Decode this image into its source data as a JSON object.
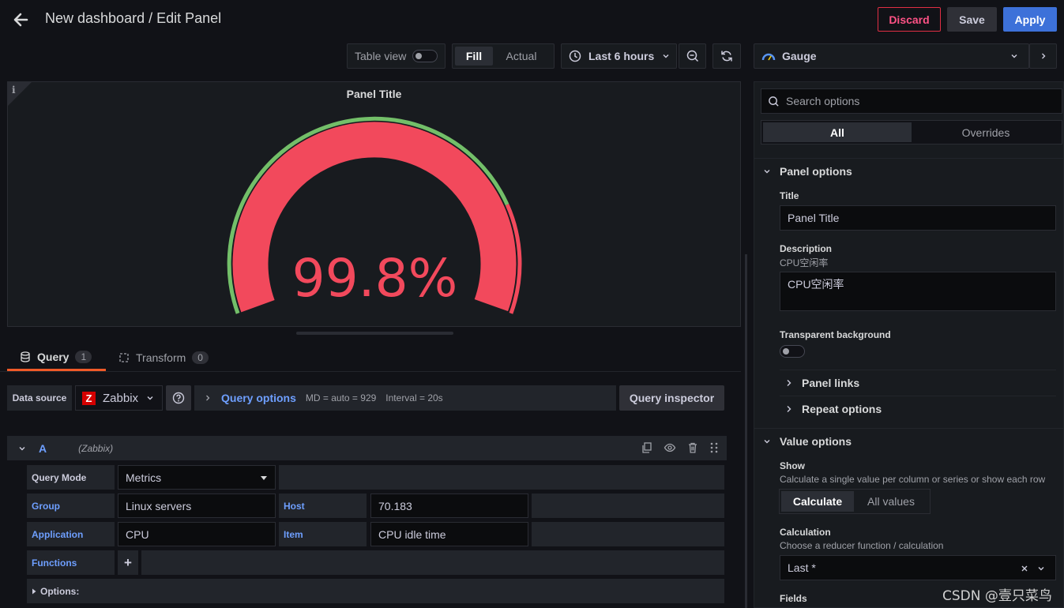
{
  "header": {
    "title": "New dashboard / Edit Panel",
    "discard_label": "Discard",
    "save_label": "Save",
    "apply_label": "Apply"
  },
  "toolbar": {
    "table_view_label": "Table view",
    "fill_label": "Fill",
    "actual_label": "Actual",
    "time_range": "Last 6 hours",
    "visualization": "Gauge"
  },
  "panel": {
    "title": "Panel Title",
    "info_icon": "i",
    "gauge_value_text": "99.8%",
    "gauge_fraction": 0.998,
    "colors": {
      "value": "#f2495c",
      "threshold_base": "#73bf69",
      "threshold_red": "#f2495c"
    }
  },
  "editor": {
    "tabs": [
      {
        "label": "Query",
        "count": "1"
      },
      {
        "label": "Transform",
        "count": "0"
      }
    ],
    "datasource_label": "Data source",
    "datasource": "Zabbix",
    "datasource_icon": "Z",
    "query_options_label": "Query options",
    "md_info": "MD = auto = 929",
    "interval_info": "Interval = 20s",
    "query_inspector_label": "Query inspector",
    "query": {
      "ref_id": "A",
      "ds_name": "(Zabbix)",
      "query_mode_label": "Query Mode",
      "query_mode": "Metrics",
      "group_label": "Group",
      "group": "Linux servers",
      "host_label": "Host",
      "host": "70.183",
      "application_label": "Application",
      "application": "CPU",
      "item_label": "Item",
      "item": "CPU idle time",
      "functions_label": "Functions",
      "add_function": "+",
      "options_label": "Options:"
    }
  },
  "options_pane": {
    "search_placeholder": "Search options",
    "tab_all": "All",
    "tab_overrides": "Overrides",
    "panel_options": {
      "section_title": "Panel options",
      "title_label": "Title",
      "title_value": "Panel Title",
      "description_label": "Description",
      "description_hint": "CPU空闲率",
      "description_value": "CPU空闲率",
      "transparent_label": "Transparent background",
      "panel_links": "Panel links",
      "repeat_options": "Repeat options"
    },
    "value_options": {
      "section_title": "Value options",
      "show_label": "Show",
      "show_desc": "Calculate a single value per column or series or show each row",
      "calculate": "Calculate",
      "all_values": "All values",
      "calculation_label": "Calculation",
      "calculation_desc": "Choose a reducer function / calculation",
      "calculation_value": "Last *",
      "fields_label": "Fields"
    }
  },
  "watermark": "CSDN @壹只菜鸟"
}
